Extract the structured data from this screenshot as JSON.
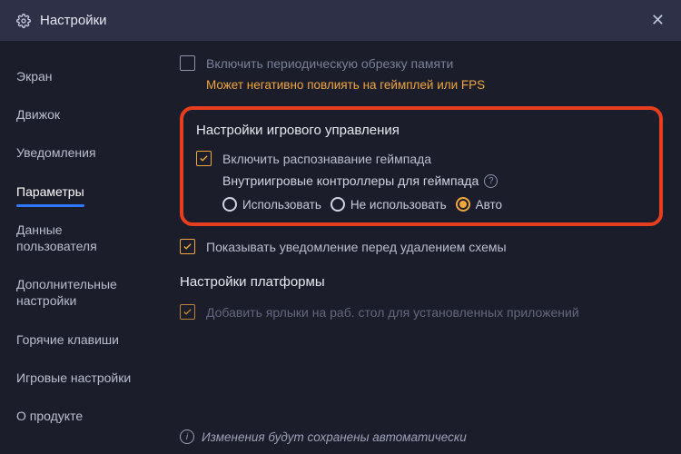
{
  "header": {
    "title": "Настройки"
  },
  "sidebar": {
    "items": [
      {
        "label": "Экран",
        "active": false
      },
      {
        "label": "Движок",
        "active": false
      },
      {
        "label": "Уведомления",
        "active": false
      },
      {
        "label": "Параметры",
        "active": true
      },
      {
        "label": "Данные пользователя",
        "active": false
      },
      {
        "label": "Дополнительные настройки",
        "active": false
      },
      {
        "label": "Горячие клавиши",
        "active": false
      },
      {
        "label": "Игровые настройки",
        "active": false
      },
      {
        "label": "О продукте",
        "active": false
      }
    ]
  },
  "content": {
    "mem_trim": {
      "label": "Включить периодическую обрезку памяти",
      "warning": "Может негативно повлиять на геймплей или FPS",
      "checked": false
    },
    "game_controls": {
      "title": "Настройки игрового управления",
      "enable_gamepad": {
        "label": "Включить распознавание геймпада",
        "checked": true
      },
      "ingame_controllers": {
        "label": "Внутриигровые контроллеры для геймпада",
        "options": {
          "use": "Использовать",
          "dont": "Не использовать",
          "auto": "Авто"
        },
        "selected": "auto"
      }
    },
    "show_notification": {
      "label": "Показывать уведомление перед удалением схемы",
      "checked": true
    },
    "platform": {
      "title": "Настройки платформы",
      "add_shortcuts": {
        "label": "Добавить ярлыки на раб. стол для установленных приложений",
        "checked": true
      }
    },
    "autosave": "Изменения будут сохранены автоматически"
  }
}
